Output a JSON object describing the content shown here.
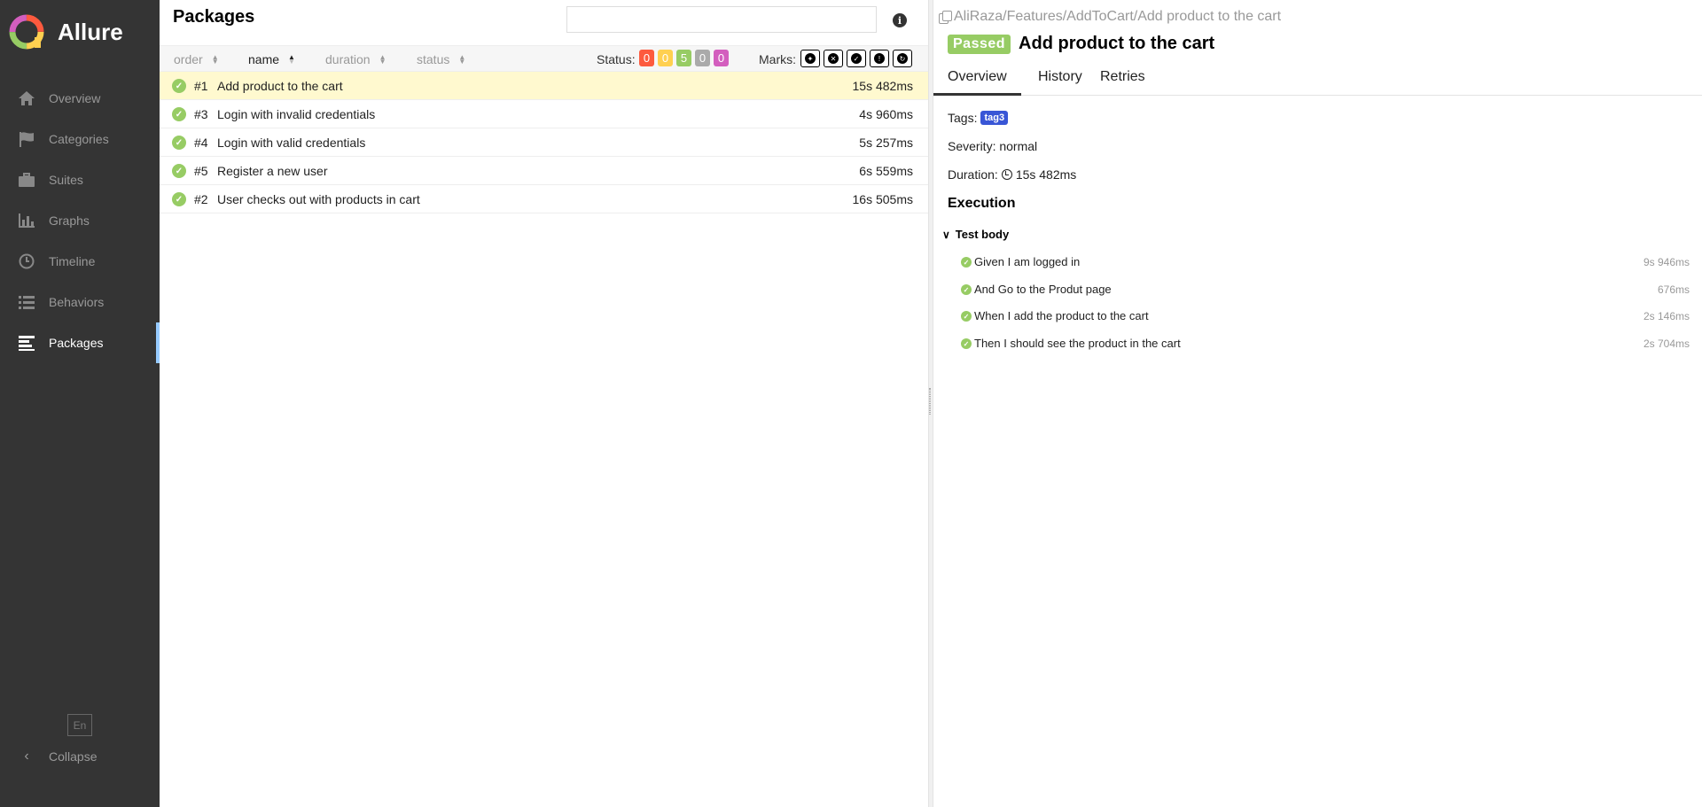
{
  "brand": {
    "name": "Allure"
  },
  "sidebar": {
    "items": [
      {
        "label": "Overview",
        "icon": "home-icon"
      },
      {
        "label": "Categories",
        "icon": "flag-icon"
      },
      {
        "label": "Suites",
        "icon": "briefcase-icon"
      },
      {
        "label": "Graphs",
        "icon": "bar-chart-icon"
      },
      {
        "label": "Timeline",
        "icon": "clock-icon"
      },
      {
        "label": "Behaviors",
        "icon": "list-icon"
      },
      {
        "label": "Packages",
        "icon": "align-left-icon",
        "active": true
      }
    ],
    "language": "En",
    "collapse_label": "Collapse"
  },
  "packages": {
    "title": "Packages",
    "search_value": "",
    "sort": {
      "order": "order",
      "name": "name",
      "duration": "duration",
      "status": "status"
    },
    "status_label": "Status:",
    "counters": [
      {
        "value": "0",
        "color": "#fd5a3e"
      },
      {
        "value": "0",
        "color": "#ffd050"
      },
      {
        "value": "5",
        "color": "#97cc64"
      },
      {
        "value": "0",
        "color": "#aaaaaa"
      },
      {
        "value": "0",
        "color": "#d35ebe"
      }
    ],
    "marks_label": "Marks:",
    "marks": [
      "flaky-icon",
      "new-failed-icon",
      "new-passed-icon",
      "new-broken-icon",
      "retries-icon"
    ],
    "rows": [
      {
        "order": "#1",
        "name": "Add product to the cart",
        "duration": "15s 482ms",
        "selected": true
      },
      {
        "order": "#3",
        "name": "Login with invalid credentials",
        "duration": "4s 960ms"
      },
      {
        "order": "#4",
        "name": "Login with valid credentials",
        "duration": "5s 257ms"
      },
      {
        "order": "#5",
        "name": "Register a new user",
        "duration": "6s 559ms"
      },
      {
        "order": "#2",
        "name": "User checks out with products in cart",
        "duration": "16s 505ms"
      }
    ]
  },
  "details": {
    "breadcrumb": "AliRaza/Features/AddToCart/Add product to the cart",
    "status": "Passed",
    "title": "Add product to the cart",
    "tabs": [
      "Overview",
      "History",
      "Retries"
    ],
    "tags_label": "Tags:",
    "tag": "tag3",
    "severity": "Severity: normal",
    "duration_label": "Duration:",
    "duration": "15s 482ms",
    "execution_title": "Execution",
    "test_body_label": "Test body",
    "steps": [
      {
        "name": "Given I am logged in",
        "duration": "9s 946ms"
      },
      {
        "name": "And Go to the Produt page",
        "duration": "676ms"
      },
      {
        "name": "When I add the product to the cart",
        "duration": "2s 146ms"
      },
      {
        "name": "Then I should see the product in the cart",
        "duration": "2s 704ms"
      }
    ]
  }
}
